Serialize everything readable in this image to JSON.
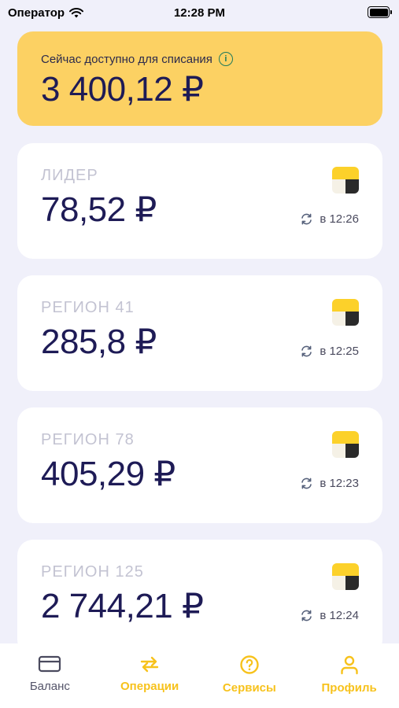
{
  "status_bar": {
    "carrier": "Оператор",
    "time": "12:28 PM"
  },
  "available": {
    "label": "Сейчас доступно для списания",
    "amount": "3 400,12 ₽"
  },
  "accounts": [
    {
      "name": "ЛИДЕР",
      "amount": "78,52 ₽",
      "updated": "в 12:26"
    },
    {
      "name": "РЕГИОН 41",
      "amount": "285,8 ₽",
      "updated": "в 12:25"
    },
    {
      "name": "РЕГИОН 78",
      "amount": "405,29 ₽",
      "updated": "в 12:23"
    },
    {
      "name": "РЕГИОН 125",
      "amount": "2 744,21 ₽",
      "updated": "в 12:24"
    }
  ],
  "tabs": [
    {
      "label": "Баланс",
      "icon": "card-icon"
    },
    {
      "label": "Операции",
      "icon": "transfer-arrows-icon"
    },
    {
      "label": "Сервисы",
      "icon": "question-circle-icon"
    },
    {
      "label": "Профиль",
      "icon": "person-icon"
    }
  ],
  "colors": {
    "background": "#f0f0fa",
    "accent_yellow": "#fcd163",
    "tab_active": "#f7c21c",
    "amount_text": "#1e1b56"
  }
}
